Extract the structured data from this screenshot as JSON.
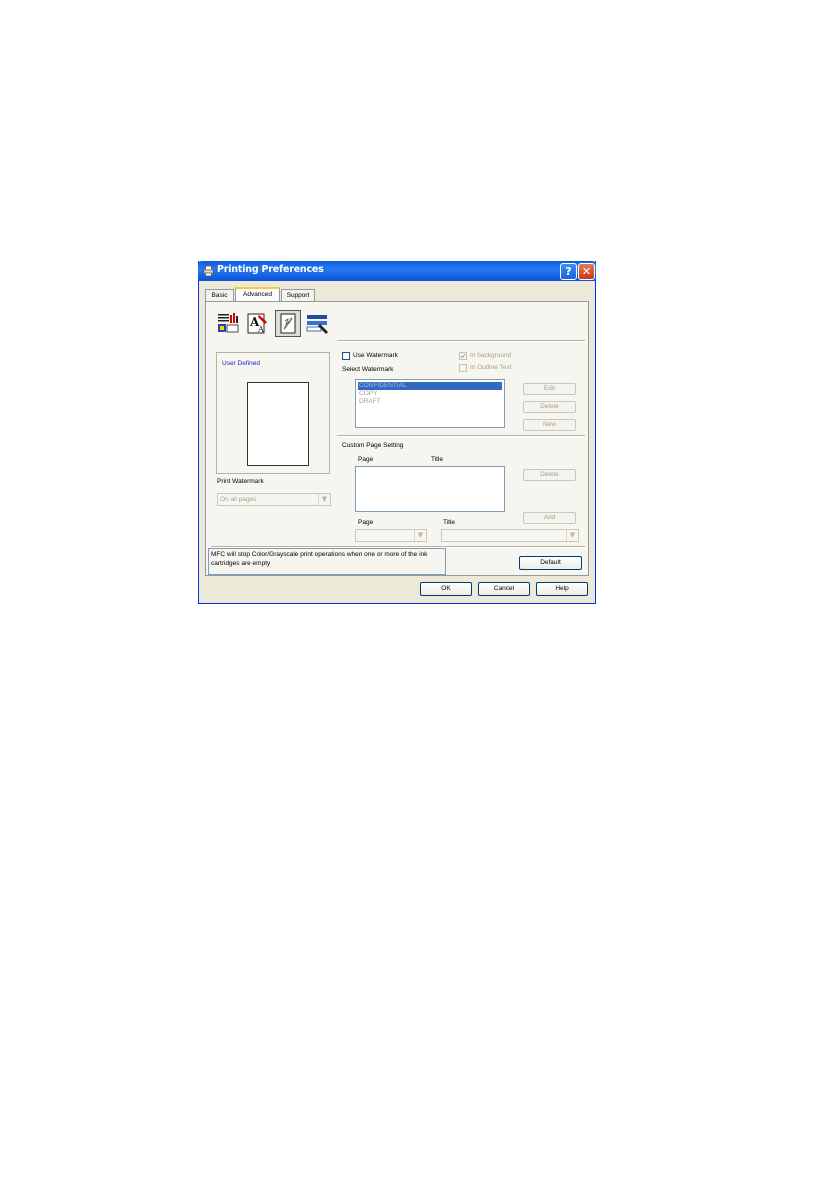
{
  "window": {
    "title": "Printing Preferences",
    "help_glyph": "?",
    "close_glyph": "✕"
  },
  "tabs": [
    {
      "label": "Basic"
    },
    {
      "label": "Advanced",
      "active": true
    },
    {
      "label": "Support"
    }
  ],
  "toolbar_icons": [
    "print-quality-icon",
    "color-adjust-icon",
    "watermark-icon",
    "device-options-icon"
  ],
  "preview": {
    "label": "User Defined",
    "print_watermark_label": "Print Watermark",
    "print_watermark_value": "On all pages"
  },
  "watermark": {
    "use_label": "Use Watermark",
    "in_background_label": "In background",
    "in_outline_label": "In Outline Text",
    "select_label": "Select Watermark",
    "items": [
      "CONFIDENTIAL",
      "COPY",
      "DRAFT"
    ],
    "edit_label": "Edit",
    "delete_label": "Delete",
    "new_label": "New"
  },
  "custom_page": {
    "heading": "Custom Page Setting",
    "col_page": "Page",
    "col_title": "Title",
    "delete_label": "Delete",
    "add_label": "Add",
    "page_label": "Page",
    "title_label": "Title"
  },
  "note_text": "MFC will stop Color/Grayscale print operations when one or more of the ink cartridges are empty",
  "buttons": {
    "default": "Default",
    "ok": "OK",
    "cancel": "Cancel",
    "help": "Help"
  },
  "colors": {
    "titlebar": "#0a5ddf",
    "dialog_bg": "#ece9d8",
    "selection": "#316ac5"
  }
}
